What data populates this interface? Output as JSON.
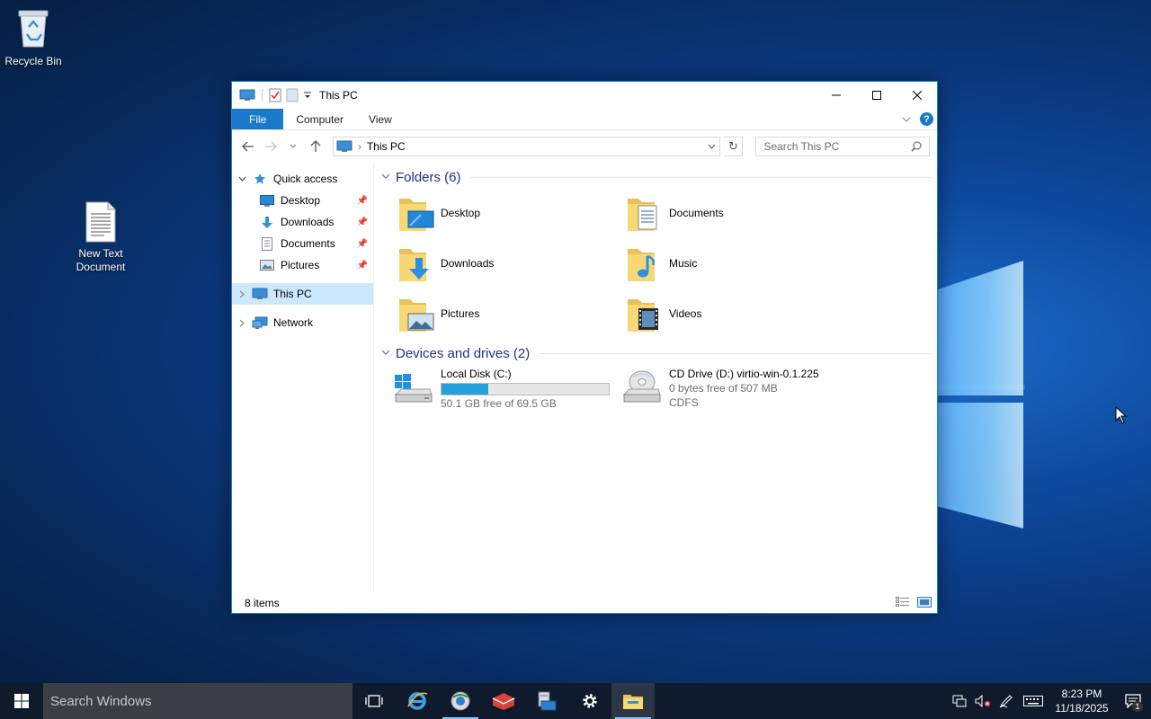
{
  "desktop": {
    "recycle_bin_label": "Recycle Bin",
    "new_text_doc_label": "New Text Document"
  },
  "window": {
    "title": "This PC",
    "ribbon_tabs": [
      "File",
      "Computer",
      "View"
    ],
    "address": "This PC",
    "search_placeholder": "Search This PC",
    "accent_color": "#1979ca"
  },
  "navpane": {
    "quick_access": "Quick access",
    "pinned": [
      {
        "label": "Desktop",
        "icon": "desktop-icon"
      },
      {
        "label": "Downloads",
        "icon": "downloads-icon"
      },
      {
        "label": "Documents",
        "icon": "documents-icon"
      },
      {
        "label": "Pictures",
        "icon": "pictures-icon"
      }
    ],
    "this_pc": "This PC",
    "network": "Network"
  },
  "content": {
    "folders_header": "Folders (6)",
    "folders": [
      {
        "label": "Desktop",
        "icon": "desktop-folder-icon"
      },
      {
        "label": "Documents",
        "icon": "documents-folder-icon"
      },
      {
        "label": "Downloads",
        "icon": "downloads-folder-icon"
      },
      {
        "label": "Music",
        "icon": "music-folder-icon"
      },
      {
        "label": "Pictures",
        "icon": "pictures-folder-icon"
      },
      {
        "label": "Videos",
        "icon": "videos-folder-icon"
      }
    ],
    "drives_header": "Devices and drives (2)",
    "drives": [
      {
        "name": "Local Disk (C:)",
        "free_text": "50.1 GB free of 69.5 GB",
        "used_fraction": 0.28
      },
      {
        "name": "CD Drive (D:) virtio-win-0.1.225",
        "free_text": "0 bytes free of 507 MB",
        "fs": "CDFS"
      }
    ]
  },
  "status": {
    "items": "8 items"
  },
  "taskbar": {
    "search_placeholder": "Search Windows",
    "time": "8:23 PM",
    "date": "11/18/2025",
    "notification_count": "1"
  }
}
